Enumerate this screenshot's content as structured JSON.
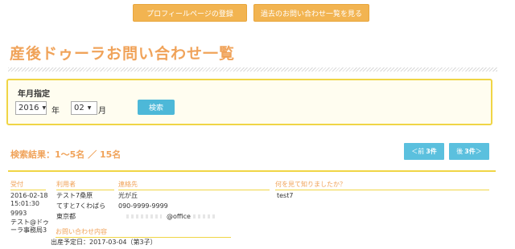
{
  "nav": {
    "profile_register_label": "プロフィールページの登録",
    "history_label": "過去のお問い合わせ一覧を見る"
  },
  "page": {
    "title": "産後ドゥーラお問い合わせ一覧"
  },
  "search": {
    "label": "年月指定",
    "year_value": "2016",
    "year_unit": "年",
    "month_value": "02",
    "month_unit": "月",
    "button_label": "検索"
  },
  "results": {
    "summary": "検索結果：1～5名 ／ 15名"
  },
  "pager": {
    "prev_prefix": "＜前",
    "prev_count": "3件",
    "next_prefix": "後",
    "next_count": "3件",
    "next_suffix": "＞"
  },
  "table": {
    "headers": {
      "received": "受付",
      "user": "利用者",
      "contact": "連絡先",
      "how_found": "何を見て知りましたか？",
      "inquiry": "お問い合わせ内容"
    },
    "rows": [
      {
        "received_date": "2016-02-18",
        "received_time": "15:01:30",
        "received_number": "9993",
        "office_line1": "テスト@ドゥ",
        "office_line2": "ーラ事務局3",
        "user_name": "テスト7桑原",
        "user_kana": "てすと7くわばら",
        "user_city": "東京都",
        "contact_address": "光が丘",
        "contact_tel": "090-9999-9999",
        "contact_mail_domain": "@office",
        "how_found": "test7",
        "inquiry": "出産予定日：2017-03-04（第3子）"
      }
    ]
  },
  "colors": {
    "accent_orange": "#f0a35a",
    "button_orange": "#f2b451",
    "button_blue": "#4db8d8",
    "highlight_yellow": "#f0d545"
  }
}
